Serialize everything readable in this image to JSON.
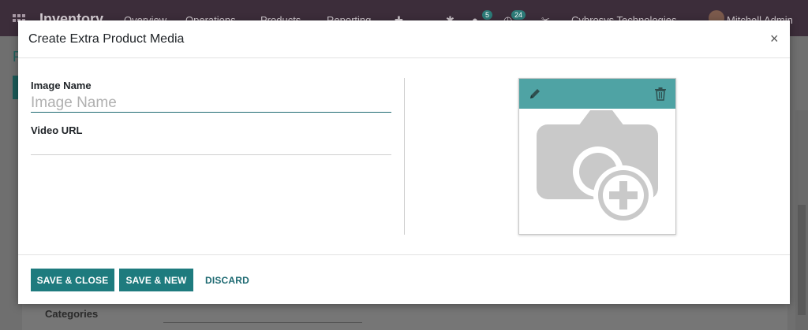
{
  "background": {
    "app_name": "Inventory",
    "menu": [
      "Overview",
      "Operations",
      "Products",
      "Reporting"
    ],
    "badges": [
      "5",
      "24"
    ],
    "company": "Cybrosys Technologies",
    "user": "Mitchell Admin",
    "breadcrumb": "P",
    "categories_label": "Categories"
  },
  "modal": {
    "title": "Create Extra Product Media",
    "close_symbol": "×",
    "fields": {
      "image_name": {
        "label": "Image Name",
        "placeholder": "Image Name",
        "value": ""
      },
      "video_url": {
        "label": "Video URL",
        "value": ""
      }
    },
    "media": {
      "edit_icon": "pencil-icon",
      "delete_icon": "trash-icon",
      "placeholder_icon": "camera-add-icon",
      "bar_color": "#4fa3a4"
    },
    "footer": {
      "save_close": "SAVE & CLOSE",
      "save_new": "SAVE & NEW",
      "discard": "DISCARD"
    }
  },
  "colors": {
    "primary": "#1e7b7e",
    "topbar": "#3c2d3a"
  }
}
